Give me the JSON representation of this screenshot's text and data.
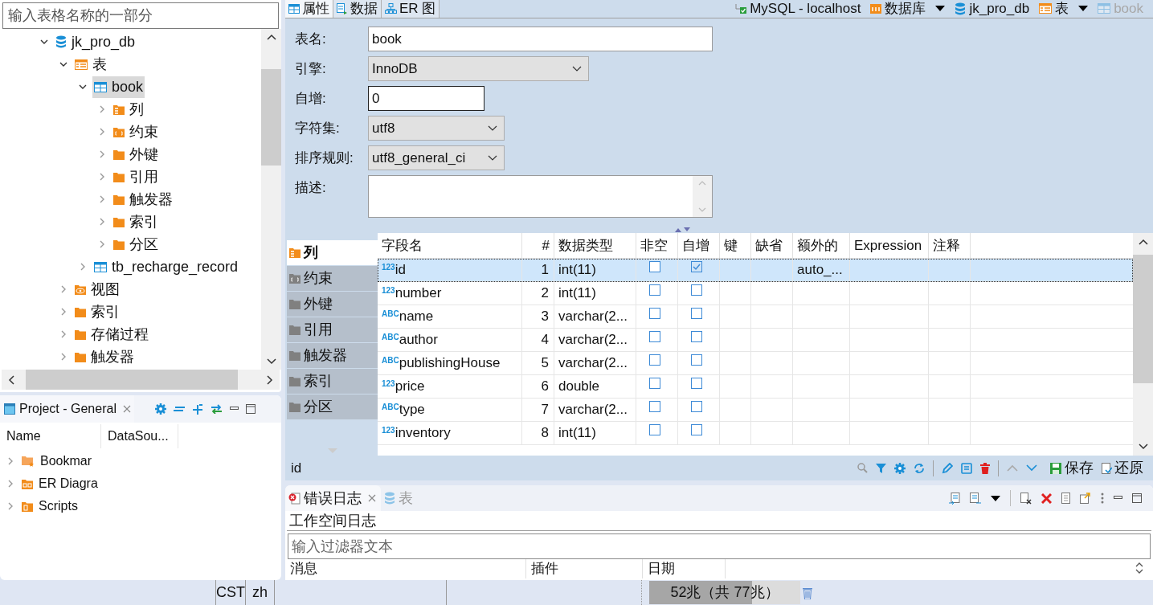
{
  "explorer": {
    "filter_placeholder": "输入表格名称的一部分",
    "tree": [
      {
        "label": "jk_pro_db",
        "kind": "database",
        "expanded": true,
        "selected": false,
        "children": [
          {
            "label": "表",
            "kind": "tables",
            "expanded": true,
            "selected": false,
            "children": [
              {
                "label": "book",
                "kind": "table",
                "expanded": true,
                "selected": true,
                "children": [
                  {
                    "label": "列",
                    "kind": "columns",
                    "expanded": false,
                    "selected": false
                  },
                  {
                    "label": "约束",
                    "kind": "constraints",
                    "expanded": false,
                    "selected": false
                  },
                  {
                    "label": "外键",
                    "kind": "folder",
                    "expanded": false,
                    "selected": false
                  },
                  {
                    "label": "引用",
                    "kind": "folder",
                    "expanded": false,
                    "selected": false
                  },
                  {
                    "label": "触发器",
                    "kind": "folder",
                    "expanded": false,
                    "selected": false
                  },
                  {
                    "label": "索引",
                    "kind": "folder",
                    "expanded": false,
                    "selected": false
                  },
                  {
                    "label": "分区",
                    "kind": "folder",
                    "expanded": false,
                    "selected": false
                  }
                ]
              },
              {
                "label": "tb_recharge_record",
                "kind": "table",
                "expanded": false,
                "selected": false
              }
            ]
          },
          {
            "label": "视图",
            "kind": "views",
            "expanded": false,
            "selected": false
          },
          {
            "label": "索引",
            "kind": "folder",
            "expanded": false,
            "selected": false
          },
          {
            "label": "存储过程",
            "kind": "folder",
            "expanded": false,
            "selected": false
          },
          {
            "label": "触发器",
            "kind": "folder",
            "expanded": false,
            "selected": false
          }
        ]
      }
    ]
  },
  "project": {
    "tab": "Project - General",
    "columns": [
      "Name",
      "DataSou..."
    ],
    "items": [
      {
        "label": "Bookmar",
        "kind": "bookmarks"
      },
      {
        "label": "ER Diagra",
        "kind": "diagrams"
      },
      {
        "label": "Scripts",
        "kind": "scripts"
      }
    ]
  },
  "editor": {
    "tabs": [
      {
        "label": "属性",
        "kind": "properties",
        "selected": true
      },
      {
        "label": "数据",
        "kind": "data",
        "selected": false
      },
      {
        "label": "ER 图",
        "kind": "er",
        "selected": false
      }
    ],
    "breadcrumbs": [
      {
        "label": "MySQL - localhost",
        "kind": "connection",
        "dropdown": false,
        "disabled": false
      },
      {
        "label": "数据库",
        "kind": "databases",
        "dropdown": true,
        "disabled": false
      },
      {
        "label": "jk_pro_db",
        "kind": "database",
        "dropdown": false,
        "disabled": false
      },
      {
        "label": "表",
        "kind": "tables",
        "dropdown": true,
        "disabled": false
      },
      {
        "label": "book",
        "kind": "table",
        "dropdown": false,
        "disabled": true
      }
    ],
    "fields": [
      {
        "label": "表名:",
        "kind": "text",
        "value": "book"
      },
      {
        "label": "引擎:",
        "kind": "select",
        "value": "InnoDB"
      },
      {
        "label": "自增:",
        "kind": "text",
        "value": "0"
      },
      {
        "label": "字符集:",
        "kind": "select",
        "value": "utf8"
      },
      {
        "label": "排序规则:",
        "kind": "select",
        "value": "utf8_general_ci"
      },
      {
        "label": "描述:",
        "kind": "textarea"
      }
    ],
    "side_tabs": [
      {
        "label": "列",
        "kind": "columns",
        "selected": true
      },
      {
        "label": "约束",
        "kind": "constraints",
        "selected": false
      },
      {
        "label": "外键",
        "kind": "folder",
        "selected": false
      },
      {
        "label": "引用",
        "kind": "folder",
        "selected": false
      },
      {
        "label": "触发器",
        "kind": "folder",
        "selected": false
      },
      {
        "label": "索引",
        "kind": "folder",
        "selected": false
      },
      {
        "label": "分区",
        "kind": "folder",
        "selected": false
      }
    ],
    "columns": [
      "字段名",
      "#",
      "数据类型",
      "非空",
      "自增",
      "键",
      "缺省",
      "额外的",
      "Expression",
      "注释"
    ],
    "rows": [
      {
        "type_label": "123",
        "name": "id",
        "index": "1",
        "data_type": "int(11)",
        "not_null": false,
        "auto_increment": true,
        "extra": "auto_...",
        "selected": true
      },
      {
        "type_label": "123",
        "name": "number",
        "index": "2",
        "data_type": "int(11)",
        "not_null": false,
        "auto_increment": false,
        "selected": false
      },
      {
        "type_label": "ABC",
        "name": "name",
        "index": "3",
        "data_type": "varchar(2...",
        "not_null": false,
        "auto_increment": false,
        "selected": false
      },
      {
        "type_label": "ABC",
        "name": "author",
        "index": "4",
        "data_type": "varchar(2...",
        "not_null": false,
        "auto_increment": false,
        "selected": false
      },
      {
        "type_label": "ABC",
        "name": "publishingHouse",
        "index": "5",
        "data_type": "varchar(2...",
        "not_null": false,
        "auto_increment": false,
        "selected": false
      },
      {
        "type_label": "123",
        "name": "price",
        "index": "6",
        "data_type": "double",
        "not_null": false,
        "auto_increment": false,
        "selected": false
      },
      {
        "type_label": "ABC",
        "name": "type",
        "index": "7",
        "data_type": "varchar(2...",
        "not_null": false,
        "auto_increment": false,
        "selected": false
      },
      {
        "type_label": "123",
        "name": "inventory",
        "index": "8",
        "data_type": "int(11)",
        "not_null": false,
        "auto_increment": false,
        "selected": false
      }
    ],
    "status_text": "id",
    "save": "保存",
    "revert": "还原"
  },
  "log": {
    "tabs": [
      {
        "label": "错误日志",
        "kind": "error-log",
        "selected": true
      },
      {
        "label": "表",
        "kind": "tables",
        "selected": false
      }
    ],
    "title": "工作空间日志",
    "filter_placeholder": "输入过滤器文本",
    "columns": [
      "消息",
      "插件",
      "日期"
    ]
  },
  "status_bar": {
    "timezone": "CST",
    "locale": "zh",
    "memory": "52兆（共 77兆）",
    "level": 0.68
  }
}
